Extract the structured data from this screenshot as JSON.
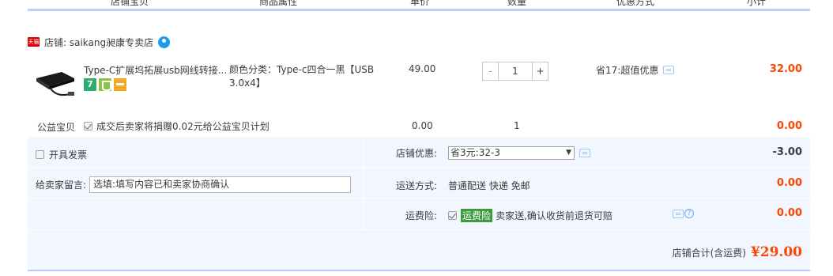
{
  "columns": [
    "店铺宝贝",
    "商品属性",
    "单价",
    "数量",
    "优惠方式",
    "小计"
  ],
  "shop": {
    "badge": "天猫",
    "name": "店铺: saikang昶康专卖店"
  },
  "item": {
    "title": "Type-C扩展坞拓展usb网线转接...",
    "sku": "颜色分类：Type-c四合一黑【USB 3.0x4】",
    "price": "49.00",
    "qty": "1",
    "qty_minus": "-",
    "qty_plus": "+",
    "discount": "省17:超值优惠",
    "total": "32.00",
    "icons": [
      "7-day-return-icon",
      "shield-icon",
      "credit-card-icon"
    ]
  },
  "charity": {
    "label": "公益宝贝",
    "desc": "成交后卖家将捐赠0.02元给公益宝贝计划",
    "price": "0.00",
    "qty": "1",
    "total": "0.00"
  },
  "options": {
    "invoice_label": "开具发票",
    "shop_discount_label": "店铺优惠:",
    "shop_discount_value": "省3元:32-3",
    "shop_discount_amount": "-3.00",
    "message_label": "给卖家留言:",
    "message_placeholder": "选填:填写内容已和卖家协商确认",
    "shipping_label": "运送方式:",
    "shipping_value": "普通配送 快递 免邮",
    "shipping_amount": "0.00",
    "insurance_label": "运费险:",
    "insurance_tag": "运费险",
    "insurance_desc": "卖家送,确认收货前退货可赔",
    "insurance_amount": "0.00"
  },
  "summary": {
    "label": "店铺合计(含运费)",
    "total": "¥29.00"
  },
  "colors": {
    "accent": "#f40",
    "header_line": "#b2d1ff",
    "option_bg": "#f2f7ff"
  }
}
